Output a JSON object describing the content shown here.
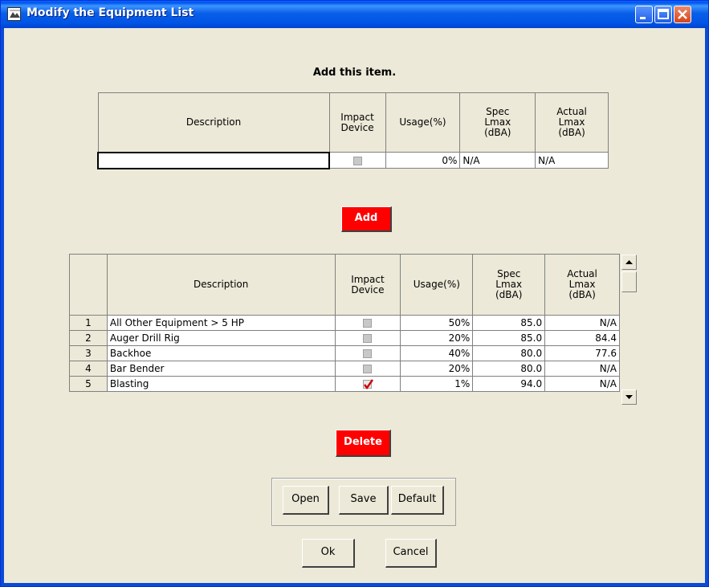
{
  "window": {
    "title": "Modify the Equipment List",
    "controls": [
      "minimize-icon",
      "maximize-icon",
      "close-icon"
    ],
    "accent": "#0055e6"
  },
  "add_section": {
    "heading": "Add this item.",
    "headers": {
      "description": "Description",
      "impact_device": [
        "Impact",
        "Device"
      ],
      "usage": "Usage(%)",
      "spec_lmax": [
        "Spec",
        "Lmax",
        "(dBA)"
      ],
      "actual_lmax": [
        "Actual",
        "Lmax",
        "(dBA)"
      ]
    },
    "row": {
      "description": "",
      "impact_device": false,
      "usage": "0%",
      "spec_lmax": "N/A",
      "actual_lmax": "N/A"
    },
    "add_button": "Add"
  },
  "equipment_table": {
    "headers": {
      "description": "Description",
      "impact_device": [
        "Impact",
        "Device"
      ],
      "usage": "Usage(%)",
      "spec_lmax": [
        "Spec",
        "Lmax",
        "(dBA)"
      ],
      "actual_lmax": [
        "Actual",
        "Lmax",
        "(dBA)"
      ]
    },
    "rows": [
      {
        "num": "1",
        "description": "All Other Equipment > 5 HP",
        "impact": false,
        "usage": "50%",
        "spec": "85.0",
        "actual": "N/A"
      },
      {
        "num": "2",
        "description": "Auger Drill Rig",
        "impact": false,
        "usage": "20%",
        "spec": "85.0",
        "actual": "84.4"
      },
      {
        "num": "3",
        "description": "Backhoe",
        "impact": false,
        "usage": "40%",
        "spec": "80.0",
        "actual": "77.6"
      },
      {
        "num": "4",
        "description": "Bar Bender",
        "impact": false,
        "usage": "20%",
        "spec": "80.0",
        "actual": "N/A"
      },
      {
        "num": "5",
        "description": "Blasting",
        "impact": true,
        "usage": "1%",
        "spec": "94.0",
        "actual": "N/A"
      }
    ],
    "delete_button": "Delete"
  },
  "file_buttons": {
    "open": "Open",
    "save": "Save",
    "default": "Default"
  },
  "dialog_buttons": {
    "ok": "Ok",
    "cancel": "Cancel"
  },
  "colors": {
    "danger_button": "#ff0000",
    "check_mark": "#cc0000"
  }
}
